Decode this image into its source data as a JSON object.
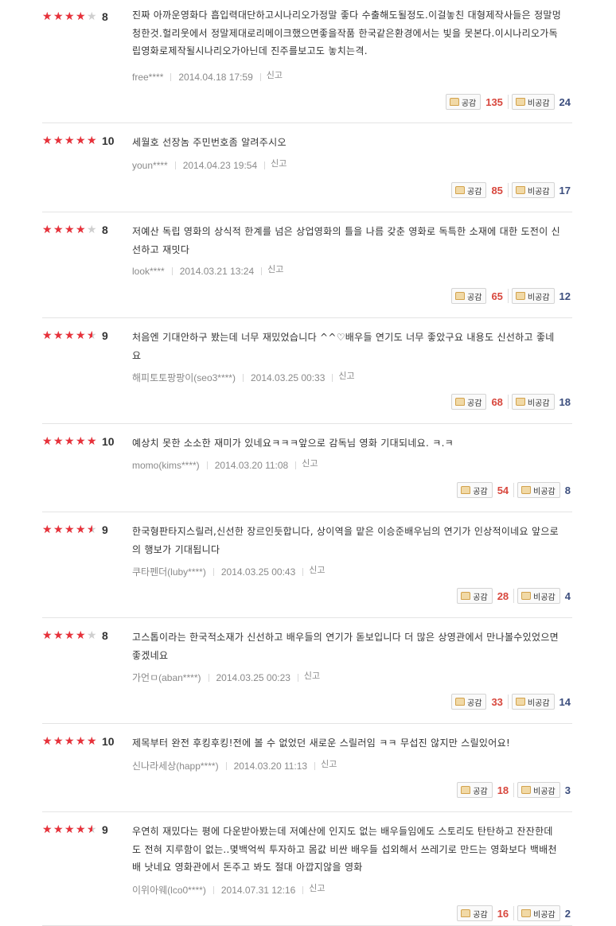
{
  "labels": {
    "like": "공감",
    "dislike": "비공감",
    "report": "신고"
  },
  "colors": {
    "star": "#e8313a",
    "star_empty": "#cfcfcf",
    "like_count": "#d8473d",
    "dislike_count": "#3c4e7e"
  },
  "reviews": [
    {
      "score": "8",
      "stars": 4,
      "text": "진짜 아까운영화다 흡입력대단하고시나리오가정말 좋다 수출해도될정도.이걸놓친 대형제작사들은 정말멍청한것.헐리웃에서 정말제대로리메이크했으면좋을작품 한국같은환경에서는 빛을 못본다.이시나리오가독립영화로제작될시나리오가아닌데 진주를보고도 놓치는격.",
      "user": "free****",
      "date": "2014.04.18 17:59",
      "likes": "135",
      "dislikes": "24"
    },
    {
      "score": "10",
      "stars": 5,
      "text": "세월호 선장놈 주민번호좀 알려주시오",
      "user": "youn****",
      "date": "2014.04.23 19:54",
      "likes": "85",
      "dislikes": "17"
    },
    {
      "score": "8",
      "stars": 4,
      "text": "저예산 독립 영화의 상식적 한계를 넘은 상업영화의 틀을 나름 갖춘 영화로 독특한 소재에 대한 도전이 신선하고 재밋다",
      "user": "look****",
      "date": "2014.03.21 13:24",
      "likes": "65",
      "dislikes": "12"
    },
    {
      "score": "9",
      "stars": 4.5,
      "text": "처음엔 기대안하구 봤는데 너무 재밌었습니다 ^^♡배우들 연기도 너무 좋았구요 내용도 신선하고 좋네요",
      "user": "해피토토팡팡이(seo3****)",
      "date": "2014.03.25 00:33",
      "likes": "68",
      "dislikes": "18"
    },
    {
      "score": "10",
      "stars": 5,
      "text": "예상치 못한 소소한 재미가 있네요ㅋㅋㅋ앞으로 감독님 영화 기대되네요. ㅋ.ㅋ",
      "user": "momo(kims****)",
      "date": "2014.03.20 11:08",
      "likes": "54",
      "dislikes": "8"
    },
    {
      "score": "9",
      "stars": 4.5,
      "text": "한국형판타지스릴러,신선한 장르인듯합니다, 상이역을 맡은 이승준배우님의 연기가 인상적이네요 앞으로의 행보가 기대됩니다",
      "user": "쿠타펜더(luby****)",
      "date": "2014.03.25 00:43",
      "likes": "28",
      "dislikes": "4"
    },
    {
      "score": "8",
      "stars": 4,
      "text": "고스톱이라는 한국적소재가 신선하고 배우들의 연기가 돋보입니다 더 많은 상영관에서 만나볼수있었으면 좋겠네요",
      "user": "가언ㅁ(aban****)",
      "date": "2014.03.25 00:23",
      "likes": "33",
      "dislikes": "14"
    },
    {
      "score": "10",
      "stars": 5,
      "text": "제목부터 완전 후킹후킹!전에 볼 수 없었던 새로운 스릴러임 ㅋㅋ 무섭진 않지만 스릴있어요!",
      "user": "신나라세상(happ****)",
      "date": "2014.03.20 11:13",
      "likes": "18",
      "dislikes": "3"
    },
    {
      "score": "9",
      "stars": 4.5,
      "text": "우연히 재밌다는 평에 다운받아봤는데 저예산에 인지도 없는 배우들임에도 스토리도 탄탄하고 잔잔한데도 전혀 지루함이 없는..몇백억씩 투자하고 몸값 비싼 배우들 섭외해서 쓰레기로 만드는 영화보다 백배천배 낫네요 영화관에서 돈주고 봐도 절대 아깝지않을 영화",
      "user": "이위아웨(lco0****)",
      "date": "2014.07.31 12:16",
      "likes": "16",
      "dislikes": "2"
    }
  ]
}
